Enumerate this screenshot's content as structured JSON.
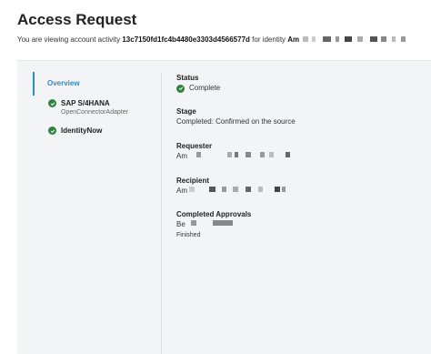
{
  "header": {
    "title": "Access Request",
    "subtitle_prefix": "You are viewing account activity",
    "activity_id": "13c7150fd1fc4b4480e3303d4566577d",
    "subtitle_mid": "for identity",
    "identity_name": "Am"
  },
  "sidebar": {
    "overview_label": "Overview",
    "items": [
      {
        "name": "SAP S/4HANA",
        "sub": "OpenConnectorAdapter",
        "status_icon": "check-circle-icon"
      },
      {
        "name": "IdentityNow",
        "sub": "",
        "status_icon": "check-circle-icon"
      }
    ]
  },
  "details": {
    "status_label": "Status",
    "status_value": "Complete",
    "stage_label": "Stage",
    "stage_value": "Completed: Confirmed on the source",
    "requester_label": "Requester",
    "requester_value": "Am",
    "recipient_label": "Recipient",
    "recipient_value": "Am",
    "approvals_label": "Completed Approvals",
    "approver_value": "Be",
    "approval_state": "Finished"
  },
  "colors": {
    "accent": "#2d8bc7",
    "success": "#2e8540",
    "panel_bg": "#f3f4f6"
  }
}
